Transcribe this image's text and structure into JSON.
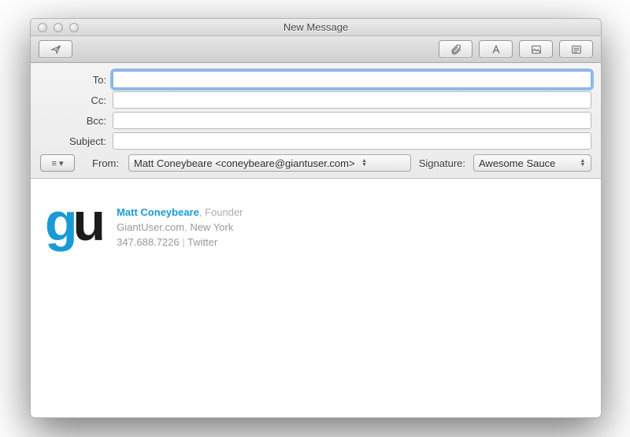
{
  "window": {
    "title": "New Message"
  },
  "fields": {
    "to_label": "To:",
    "cc_label": "Cc:",
    "bcc_label": "Bcc:",
    "subject_label": "Subject:",
    "to_value": "",
    "cc_value": "",
    "bcc_value": "",
    "subject_value": ""
  },
  "from": {
    "label": "From:",
    "value": "Matt Coneybeare <coneybeare@giantuser.com>"
  },
  "signature": {
    "label": "Signature:",
    "value": "Awesome Sauce"
  },
  "options_button": "≡ ▾",
  "body_signature": {
    "logo_g": "g",
    "logo_u": "u",
    "name": "Matt Coneybeare",
    "title_sep": ", ",
    "title": "Founder",
    "site": "GiantUser.com",
    "site_sep": ", ",
    "location": "New York",
    "phone": "347.688.7226",
    "pipe": " | ",
    "twitter": "Twitter"
  }
}
